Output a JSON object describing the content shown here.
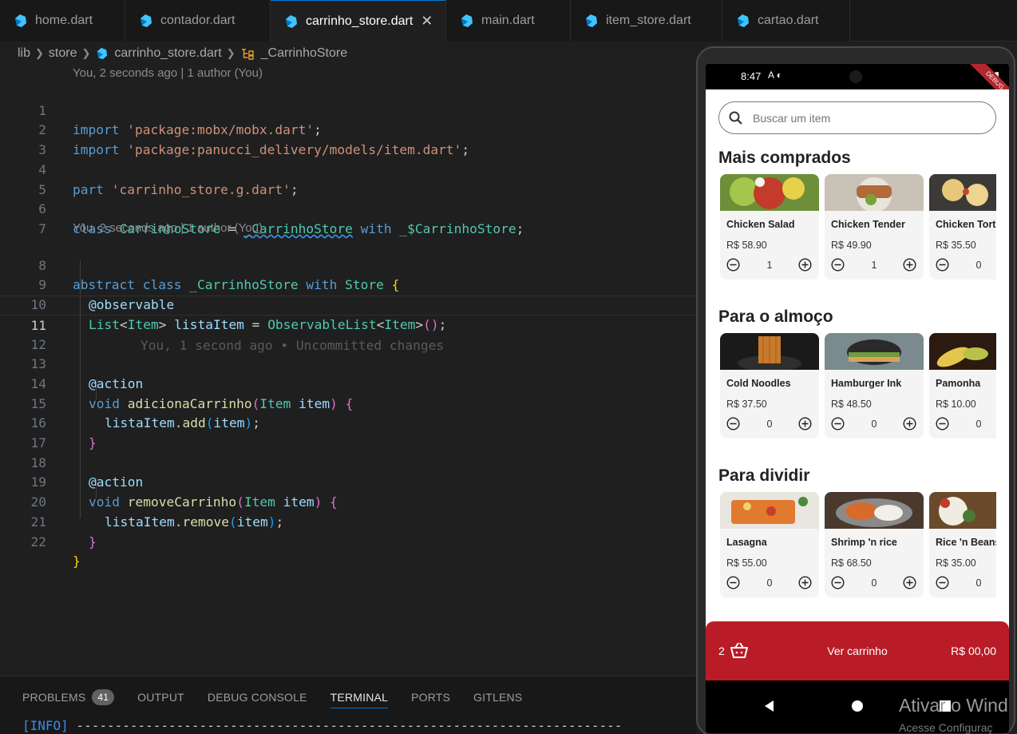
{
  "tabs": [
    {
      "label": "home.dart",
      "active": false
    },
    {
      "label": "contador.dart",
      "active": false
    },
    {
      "label": "carrinho_store.dart",
      "active": true
    },
    {
      "label": "main.dart",
      "active": false
    },
    {
      "label": "item_store.dart",
      "active": false
    },
    {
      "label": "cartao.dart",
      "active": false
    }
  ],
  "tab_close": "✕",
  "breadcrumb": [
    "lib",
    "store",
    "carrinho_store.dart",
    "_CarrinhoStore"
  ],
  "editor": {
    "blame_top": "You, 2 seconds ago | 1 author (You)",
    "blame_class": "You, 2 seconds ago | 1 author (You)",
    "ghost_line_11": "You, 1 second ago • Uncommitted changes",
    "line_numbers": [
      "1",
      "2",
      "3",
      "4",
      "5",
      "6",
      "7",
      "8",
      "9",
      "10",
      "11",
      "12",
      "13",
      "14",
      "15",
      "16",
      "17",
      "18",
      "19",
      "20",
      "21",
      "22"
    ],
    "l1": {
      "kw": "import",
      "str": "'package:mobx/mobx.dart'",
      "end": ";"
    },
    "l2": {
      "kw": "import",
      "str": "'package:panucci_delivery/models/item.dart'",
      "end": ";"
    },
    "l4": {
      "kw": "part",
      "str": "'carrinho_store.g.dart'",
      "end": ";"
    },
    "l6": {
      "kw": "class",
      "cls": "CarrinhoStore",
      "eq": " = ",
      "mixin": "_CarrinhoStore",
      "with": "with",
      "gen": "_$CarrinhoStore",
      "end": ";"
    },
    "l8": {
      "kw1": "abstract",
      "kw2": "class",
      "cls": "_CarrinhoStore",
      "with": "with",
      "store": "Store",
      "brace": "{"
    },
    "l9": {
      "deco": "@observable"
    },
    "l10": {
      "type": "List",
      "lt": "<",
      "item": "Item",
      "gt": ">",
      "var": "listaItem",
      "eq": " = ",
      "obs": "ObservableList",
      "lt2": "<",
      "item2": "Item",
      "gt2": ">",
      "parens": "()",
      "end": ";"
    },
    "l13": {
      "deco": "@action"
    },
    "l14": {
      "kw": "void",
      "fn": "adicionaCarrinho",
      "p1": "(",
      "type": "Item",
      "var": "item",
      "p2": ")",
      "brace": "{"
    },
    "l15": {
      "var": "listaItem",
      "dot": ".",
      "fn": "add",
      "p1": "(",
      "arg": "item",
      "p2": ")",
      "end": ";"
    },
    "l16": {
      "brace": "}"
    },
    "l18": {
      "deco": "@action"
    },
    "l19": {
      "kw": "void",
      "fn": "removeCarrinho",
      "p1": "(",
      "type": "Item",
      "var": "item",
      "p2": ")",
      "brace": "{"
    },
    "l20": {
      "var": "listaItem",
      "dot": ".",
      "fn": "remove",
      "p1": "(",
      "arg": "item",
      "p2": ")",
      "end": ";"
    },
    "l21": {
      "brace": "}"
    },
    "l22": {
      "brace": "}"
    }
  },
  "panel": {
    "tabs": [
      "PROBLEMS",
      "OUTPUT",
      "DEBUG CONSOLE",
      "TERMINAL",
      "PORTS",
      "GITLENS"
    ],
    "problems_count": "41",
    "active_tab": "TERMINAL",
    "terminal_info": "[INFO]",
    "terminal_rule": " -----------------------------------------------------------------------"
  },
  "phone": {
    "time": "8:47",
    "status_icons": "A ◐",
    "status_right": "▼ ▮",
    "debug_banner": "DEBUG",
    "search_placeholder": "Buscar um item",
    "sections": [
      {
        "title": "Mais comprados",
        "items": [
          {
            "name": "Chicken Salad",
            "price": "R$ 58.90",
            "qty": "1"
          },
          {
            "name": "Chicken Tender",
            "price": "R$ 49.90",
            "qty": "1"
          },
          {
            "name": "Chicken Tort",
            "price": "R$ 35.50",
            "qty": "0"
          }
        ]
      },
      {
        "title": "Para o almoço",
        "items": [
          {
            "name": "Cold Noodles",
            "price": "R$ 37.50",
            "qty": "0"
          },
          {
            "name": "Hamburger Ink",
            "price": "R$ 48.50",
            "qty": "0"
          },
          {
            "name": "Pamonha",
            "price": "R$ 10.00",
            "qty": "0"
          }
        ]
      },
      {
        "title": "Para dividir",
        "items": [
          {
            "name": "Lasagna",
            "price": "R$ 55.00",
            "qty": "0"
          },
          {
            "name": "Shrimp 'n rice",
            "price": "R$ 68.50",
            "qty": "0"
          },
          {
            "name": "Rice 'n Beans",
            "price": "R$ 35.00",
            "qty": "0"
          }
        ]
      }
    ],
    "cart": {
      "count": "2",
      "label": "Ver carrinho",
      "total": "R$ 00,00"
    }
  },
  "watermark": {
    "title": "Ativar o Wind",
    "subtitle": "Acesse Configuraç"
  },
  "colors": {
    "accent": "#0078d4",
    "cart": "#b91c26",
    "keyword": "#569cd6",
    "string": "#ce9178",
    "class": "#4ec9b0"
  }
}
